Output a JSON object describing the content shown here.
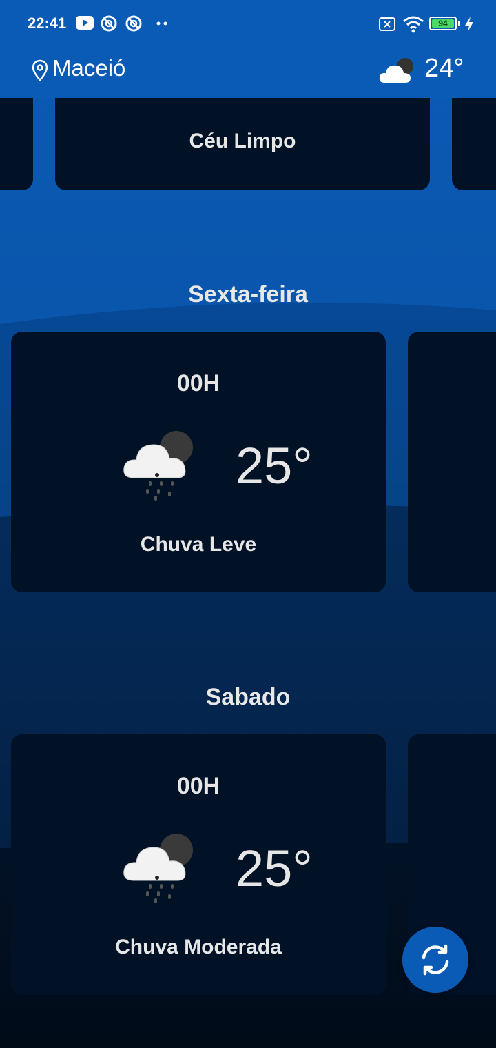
{
  "status_bar": {
    "time": "22:41",
    "battery": "94",
    "icons": [
      "youtube-icon",
      "at-sign-icon",
      "at-sign-icon",
      "dots-icon",
      "no-sim-icon",
      "wifi-icon",
      "battery-icon",
      "charging-icon"
    ]
  },
  "header": {
    "location": "Maceió",
    "temperature": "24°",
    "icons": [
      "location-pin-icon",
      "cloudy-night-icon"
    ]
  },
  "top_row": {
    "center_label": "Céu Limpo"
  },
  "days": [
    {
      "title": "Sexta-feira",
      "hour": "00H",
      "temperature": "25°",
      "description": "Chuva Leve",
      "icon": "rain-cloud-icon"
    },
    {
      "title": "Sabado",
      "hour": "00H",
      "temperature": "25°",
      "description": "Chuva Moderada",
      "icon": "rain-cloud-icon"
    }
  ],
  "fab": {
    "icon": "refresh-icon"
  },
  "colors": {
    "primary": "#0a5bb5",
    "card": "#011126",
    "text": "#e6e6e6",
    "bg_top": "#0a5ab4",
    "bg_bottom": "#010b18"
  }
}
